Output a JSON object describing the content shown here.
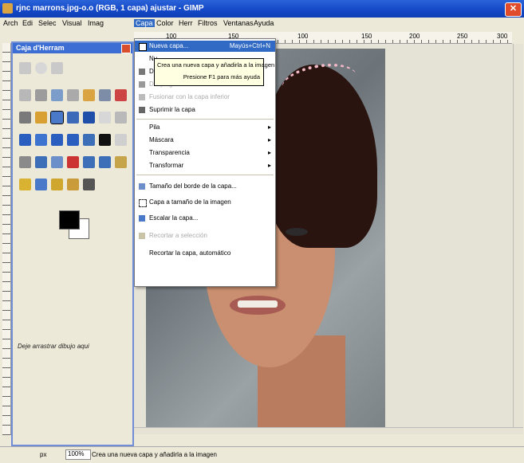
{
  "window": {
    "title": "rjnc marrons.jpg-o.o (RGB, 1 capa) ajustar - GIMP",
    "close_glyph": "✕"
  },
  "menubar": {
    "items": [
      "Arch",
      "Edi",
      "Selec",
      "Visual",
      "Imag",
      "Capa",
      "Color",
      "Herr",
      "Filtros",
      "Ventanas",
      "Ayuda"
    ],
    "active": "Capa"
  },
  "ruler": {
    "ticks": [
      "100",
      "150",
      "100",
      "150",
      "200",
      "250",
      "300"
    ]
  },
  "toolbox": {
    "title": "Caja d'Herram",
    "hint": "Deje arrastrar dibujo aqui"
  },
  "layer_menu": {
    "items": [
      {
        "label": "Nueva capa...",
        "shortcut": "Mayús+Ctrl+N",
        "icon": "new-layer-icon",
        "highlighted": true
      },
      {
        "label": "Nu...",
        "shortcut": "",
        "icon": ""
      },
      {
        "label": "D...",
        "shortcut": "",
        "icon": "duplicate-icon"
      },
      {
        "label": "Desplegar",
        "shortcut": "",
        "icon": "anchor-icon",
        "disabled": true
      },
      {
        "label": "Fusionar con la capa inferior",
        "shortcut": "",
        "icon": "merge-icon",
        "disabled": true
      },
      {
        "label": "Suprimir la capa",
        "shortcut": "",
        "icon": "delete-icon"
      },
      {
        "label": "Pila",
        "submenu": true
      },
      {
        "label": "Máscara",
        "submenu": true
      },
      {
        "label": "Transparencia",
        "submenu": true
      },
      {
        "label": "Transformar",
        "submenu": true
      },
      {
        "label": "Tamaño del borde de la capa...",
        "icon": "layer-boundary-icon"
      },
      {
        "label": "Capa a tamaño de la imagen",
        "icon": "layer-to-image-icon"
      },
      {
        "label": "Escalar la capa...",
        "icon": "scale-icon"
      },
      {
        "label": "Recortar a selección",
        "icon": "crop-icon",
        "disabled": true
      },
      {
        "label": "Recortar la capa, automático",
        "icon": ""
      }
    ]
  },
  "tooltip": {
    "line1": "Crea una nueva capa y añadirla a la imagen",
    "line2": "Presione F1 para más ayuda"
  },
  "statusbar": {
    "unit": "px",
    "zoom": "100%",
    "message": "Crea una nueva capa y añadirla a la imagen"
  }
}
